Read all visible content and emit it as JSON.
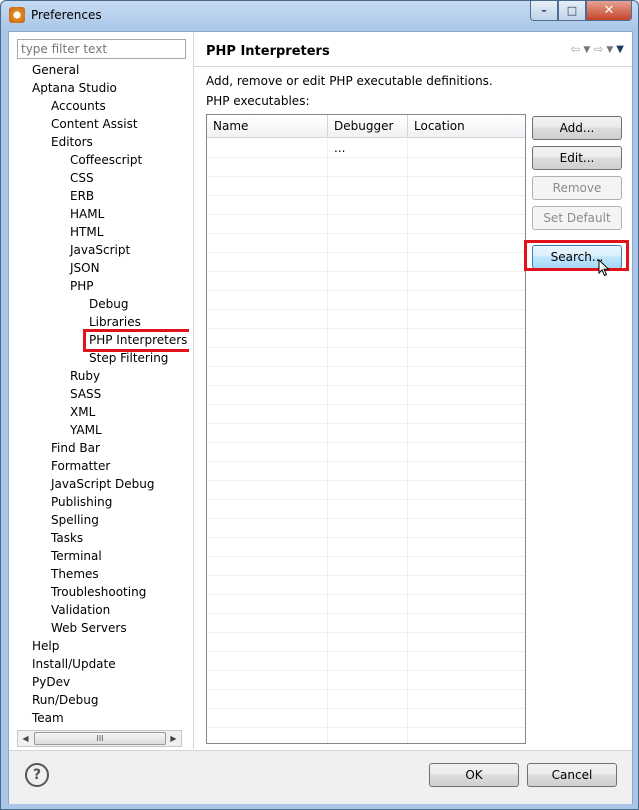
{
  "window": {
    "title": "Preferences",
    "controls": {
      "minimize": "–",
      "maximize": "□",
      "close": "✕"
    }
  },
  "filter": {
    "placeholder": "type filter text"
  },
  "tree": [
    {
      "label": "General",
      "level": 1
    },
    {
      "label": "Aptana Studio",
      "level": 1
    },
    {
      "label": "Accounts",
      "level": 2
    },
    {
      "label": "Content Assist",
      "level": 2
    },
    {
      "label": "Editors",
      "level": 2
    },
    {
      "label": "Coffeescript",
      "level": 3
    },
    {
      "label": "CSS",
      "level": 3
    },
    {
      "label": "ERB",
      "level": 3
    },
    {
      "label": "HAML",
      "level": 3
    },
    {
      "label": "HTML",
      "level": 3
    },
    {
      "label": "JavaScript",
      "level": 3
    },
    {
      "label": "JSON",
      "level": 3
    },
    {
      "label": "PHP",
      "level": 3
    },
    {
      "label": "Debug",
      "level": 4
    },
    {
      "label": "Libraries",
      "level": 4
    },
    {
      "label": "PHP Interpreters",
      "level": 4,
      "selected": true
    },
    {
      "label": "Step Filtering",
      "level": 4
    },
    {
      "label": "Ruby",
      "level": 3
    },
    {
      "label": "SASS",
      "level": 3
    },
    {
      "label": "XML",
      "level": 3
    },
    {
      "label": "YAML",
      "level": 3
    },
    {
      "label": "Find Bar",
      "level": 2
    },
    {
      "label": "Formatter",
      "level": 2
    },
    {
      "label": "JavaScript Debug",
      "level": 2
    },
    {
      "label": "Publishing",
      "level": 2
    },
    {
      "label": "Spelling",
      "level": 2
    },
    {
      "label": "Tasks",
      "level": 2
    },
    {
      "label": "Terminal",
      "level": 2
    },
    {
      "label": "Themes",
      "level": 2
    },
    {
      "label": "Troubleshooting",
      "level": 2
    },
    {
      "label": "Validation",
      "level": 2
    },
    {
      "label": "Web Servers",
      "level": 2
    },
    {
      "label": "Help",
      "level": 1
    },
    {
      "label": "Install/Update",
      "level": 1
    },
    {
      "label": "PyDev",
      "level": 1
    },
    {
      "label": "Run/Debug",
      "level": 1
    },
    {
      "label": "Team",
      "level": 1
    }
  ],
  "scrollbar": {
    "left_arrow": "◀",
    "right_arrow": "▶",
    "grip": "III"
  },
  "page": {
    "title": "PHP Interpreters",
    "nav": {
      "back": "⇦",
      "back_menu": "▼",
      "forward": "⇨",
      "forward_menu": "▼",
      "view_menu": "▼"
    },
    "description": "Add, remove or edit PHP executable definitions.",
    "executables_label": "PHP executables:",
    "columns": [
      "Name",
      "Debugger ...",
      "Location"
    ]
  },
  "buttons": {
    "add": "Add...",
    "edit": "Edit...",
    "remove": "Remove",
    "set_default": "Set Default",
    "search": "Search..."
  },
  "dialog": {
    "help": "?",
    "ok": "OK",
    "cancel": "Cancel"
  },
  "colors": {
    "highlight": "#e0121c",
    "title_gradient": "#a9c6e8"
  }
}
